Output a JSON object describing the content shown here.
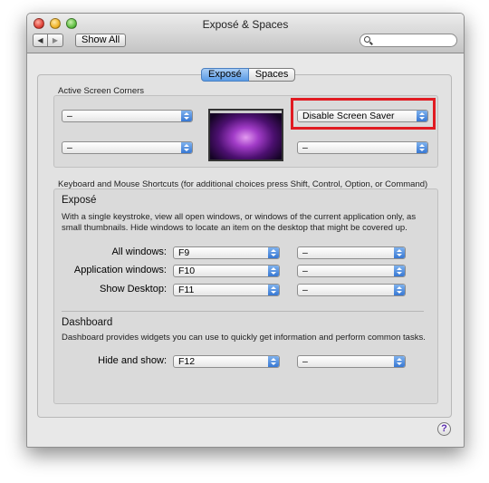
{
  "window": {
    "title": "Exposé & Spaces"
  },
  "toolbar": {
    "back_arrow": "◀",
    "forward_arrow": "▶",
    "show_all": "Show All",
    "search_placeholder": ""
  },
  "tabs": [
    {
      "label": "Exposé",
      "active": true
    },
    {
      "label": "Spaces",
      "active": false
    }
  ],
  "corners": {
    "label": "Active Screen Corners",
    "top_left": "–",
    "bottom_left": "–",
    "top_right": "Disable Screen Saver",
    "bottom_right": "–"
  },
  "shortcuts": {
    "label": "Keyboard and Mouse Shortcuts (for additional choices press Shift, Control, Option, or Command)"
  },
  "expose": {
    "heading": "Exposé",
    "description": "With a single keystroke, view all open windows, or windows of the current application only, as small thumbnails. Hide windows to locate an item on the desktop that might be covered up.",
    "rows": [
      {
        "label": "All windows:",
        "key": "F9",
        "mouse": "–"
      },
      {
        "label": "Application windows:",
        "key": "F10",
        "mouse": "–"
      },
      {
        "label": "Show Desktop:",
        "key": "F11",
        "mouse": "–"
      }
    ]
  },
  "dashboard": {
    "heading": "Dashboard",
    "description": "Dashboard provides widgets you can use to quickly get information and perform common tasks.",
    "rows": [
      {
        "label": "Hide and show:",
        "key": "F12",
        "mouse": "–"
      }
    ]
  },
  "help": {
    "glyph": "?"
  },
  "colors": {
    "highlight": "#e11b22",
    "accent": "#3778d3"
  }
}
